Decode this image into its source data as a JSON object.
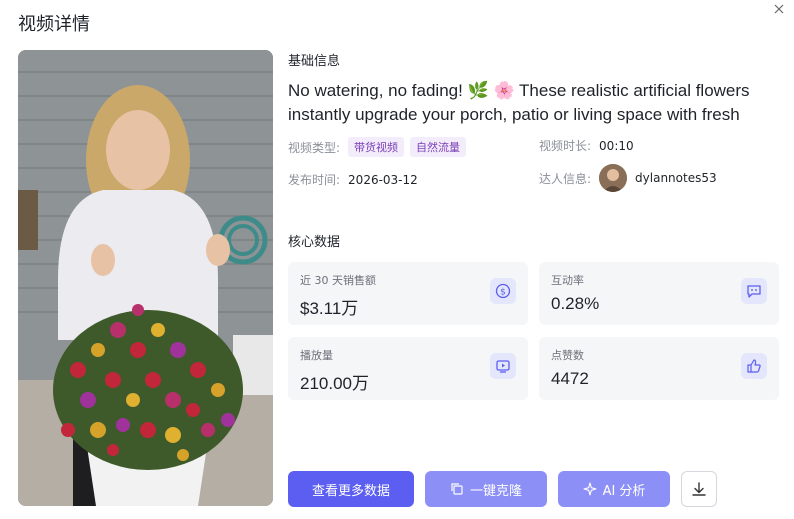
{
  "dialog": {
    "title": "视频详情"
  },
  "basic": {
    "section_title": "基础信息",
    "video_title": "No watering, no fading! 🌿 🌸 These realistic artificial flowers instantly upgrade your porch, patio or living space with fresh color all year",
    "type_label": "视频类型:",
    "tags": [
      "带货视频",
      "自然流量"
    ],
    "duration_label": "视频时长:",
    "duration": "00:10",
    "publish_label": "发布时间:",
    "publish_date": "2026-03-12",
    "creator_label": "达人信息:",
    "creator_name": "dylannotes53"
  },
  "core": {
    "section_title": "核心数据",
    "cards": [
      {
        "label": "近 30 天销售额",
        "value": "$3.11万",
        "icon": "dollar-circle-icon"
      },
      {
        "label": "互动率",
        "value": "0.28%",
        "icon": "chat-bubble-icon"
      },
      {
        "label": "播放量",
        "value": "210.00万",
        "icon": "play-screen-icon"
      },
      {
        "label": "点赞数",
        "value": "4472",
        "icon": "thumbs-up-icon"
      }
    ]
  },
  "actions": {
    "more_data": "查看更多数据",
    "clone": "一键克隆",
    "ai": "AI 分析"
  },
  "colors": {
    "primary": "#5b5ef0",
    "primary_light": "#8c8ff5",
    "card_bg": "#f5f6f8",
    "tag_bg": "#f3ecfb",
    "tag_text": "#7b3fb8"
  }
}
